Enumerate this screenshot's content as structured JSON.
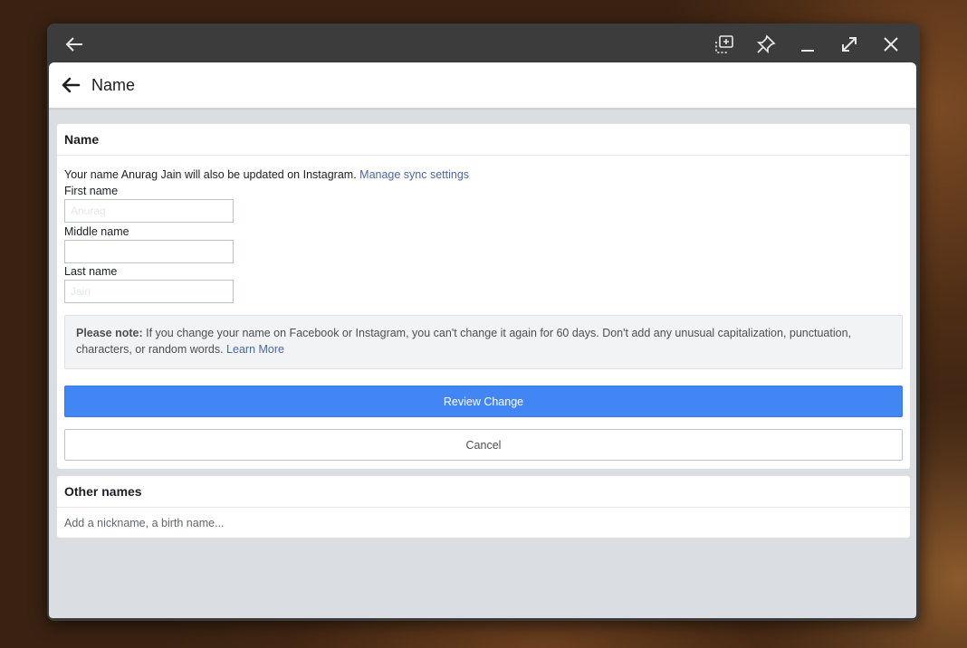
{
  "window": {
    "controls": {
      "back_icon": "arrow-left-icon",
      "screenshot_icon": "screenshot-select-icon",
      "pin_icon": "pin-icon",
      "minimize_icon": "minimize-icon",
      "maximize_icon": "maximize-icon",
      "close_icon": "close-icon"
    }
  },
  "header": {
    "title": "Name"
  },
  "name_section": {
    "heading": "Name",
    "info_text": "Your name Anurag Jain will also be updated on Instagram.",
    "sync_link": "Manage sync settings",
    "fields": [
      {
        "label": "First name",
        "value": "Anurag",
        "placeholder": ""
      },
      {
        "label": "Middle name",
        "value": "",
        "placeholder": ""
      },
      {
        "label": "Last name",
        "value": "Jain",
        "placeholder": ""
      }
    ],
    "note": {
      "label": "Please note:",
      "text": "If you change your name on Facebook or Instagram, you can't change it again for 60 days. Don't add any unusual capitalization, punctuation, characters, or random words.",
      "link": "Learn More"
    },
    "review_button": "Review Change",
    "cancel_button": "Cancel"
  },
  "other_names": {
    "heading": "Other names",
    "add_link": "Add a nickname, a birth name..."
  },
  "colors": {
    "accent": "#4285f4",
    "link": "#4b67a1",
    "page_bg": "#dadde1",
    "titlebar": "#3c3c3c"
  }
}
